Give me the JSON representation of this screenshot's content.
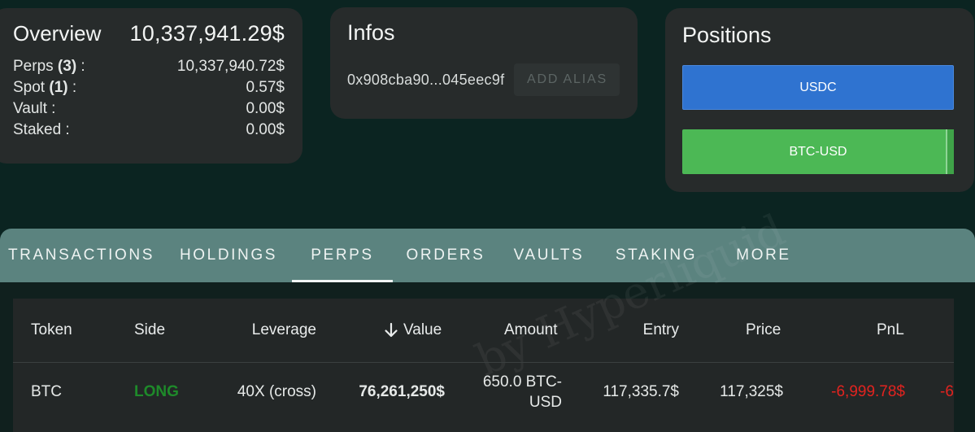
{
  "overview": {
    "title": "Overview",
    "total": "10,337,941.29$",
    "rows": [
      {
        "label": "Perps",
        "count": "(3)",
        "suffix": " :",
        "value": "10,337,940.72$"
      },
      {
        "label": "Spot",
        "count": "(1)",
        "suffix": " :",
        "value": "0.57$"
      },
      {
        "label": "Vault :",
        "count": "",
        "suffix": "",
        "value": "0.00$"
      },
      {
        "label": "Staked :",
        "count": "",
        "suffix": "",
        "value": "0.00$"
      }
    ]
  },
  "infos": {
    "title": "Infos",
    "address": "0x908cba90...045eec9f",
    "add_alias_label": "ADD ALIAS"
  },
  "positions": {
    "title": "Positions",
    "items": [
      {
        "label": "USDC",
        "color": "#2f73d0"
      },
      {
        "label": "BTC-USD",
        "color": "#4cb855"
      }
    ]
  },
  "tabs": [
    {
      "label": "TRANSACTIONS"
    },
    {
      "label": "HOLDINGS"
    },
    {
      "label": "PERPS",
      "active": true
    },
    {
      "label": "ORDERS"
    },
    {
      "label": "VAULTS"
    },
    {
      "label": "STAKING"
    },
    {
      "label": "MORE"
    }
  ],
  "table": {
    "sort_icon": "arrow-down-icon",
    "columns": [
      "Token",
      "Side",
      "Leverage",
      "Value",
      "Amount",
      "Entry",
      "Price",
      "PnL"
    ],
    "rows": [
      {
        "token": "BTC",
        "side": "LONG",
        "leverage": "40X (cross)",
        "value": "76,261,250$",
        "amount_line1": "650.0 BTC-",
        "amount_line2": "USD",
        "entry": "117,335.7$",
        "price": "117,325$",
        "pnl": "-6,999.78$",
        "pnl_overflow": "-6"
      }
    ]
  },
  "watermark": "by Hyperliquid",
  "colors": {
    "background": "#0b2421",
    "card": "#272b2b",
    "tab_bar": "#5b837f",
    "long": "#1e8a2a",
    "negative": "#e2231f"
  }
}
